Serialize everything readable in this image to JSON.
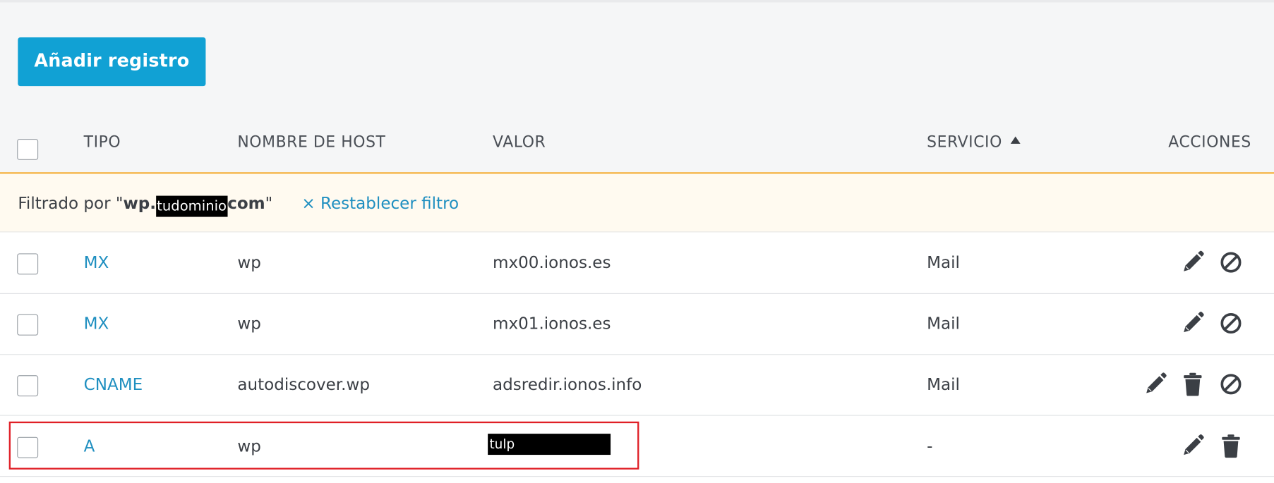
{
  "toolbar": {
    "add_label": "Añadir registro"
  },
  "columns": {
    "type": "TIPO",
    "host": "NOMBRE DE HOST",
    "value": "VALOR",
    "service": "SERVICIO",
    "actions": "ACCIONES"
  },
  "filter": {
    "prefix": "Filtrado por \"",
    "bold_start": "wp.",
    "redacted": "tudominio",
    "bold_end": "com",
    "suffix": "\"",
    "reset_icon": "×",
    "reset_label": "Restablecer filtro"
  },
  "rows": [
    {
      "type": "MX",
      "host": "wp",
      "value": "mx00.ionos.es",
      "service": "Mail",
      "actions": [
        "edit-icon",
        "disable-icon"
      ]
    },
    {
      "type": "MX",
      "host": "wp",
      "value": "mx01.ionos.es",
      "service": "Mail",
      "actions": [
        "edit-icon",
        "disable-icon"
      ]
    },
    {
      "type": "CNAME",
      "host": "autodiscover.wp",
      "value": "adsredir.ionos.info",
      "service": "Mail",
      "actions": [
        "edit-icon",
        "delete-icon",
        "disable-icon"
      ]
    },
    {
      "type": "A",
      "host": "wp",
      "value": "tulp",
      "service": "-",
      "actions": [
        "edit-icon",
        "delete-icon"
      ]
    }
  ],
  "colors": {
    "accent": "#11a1d4",
    "link": "#1f8fc0",
    "filter_border": "#f5b342",
    "highlight": "#e01f26"
  }
}
